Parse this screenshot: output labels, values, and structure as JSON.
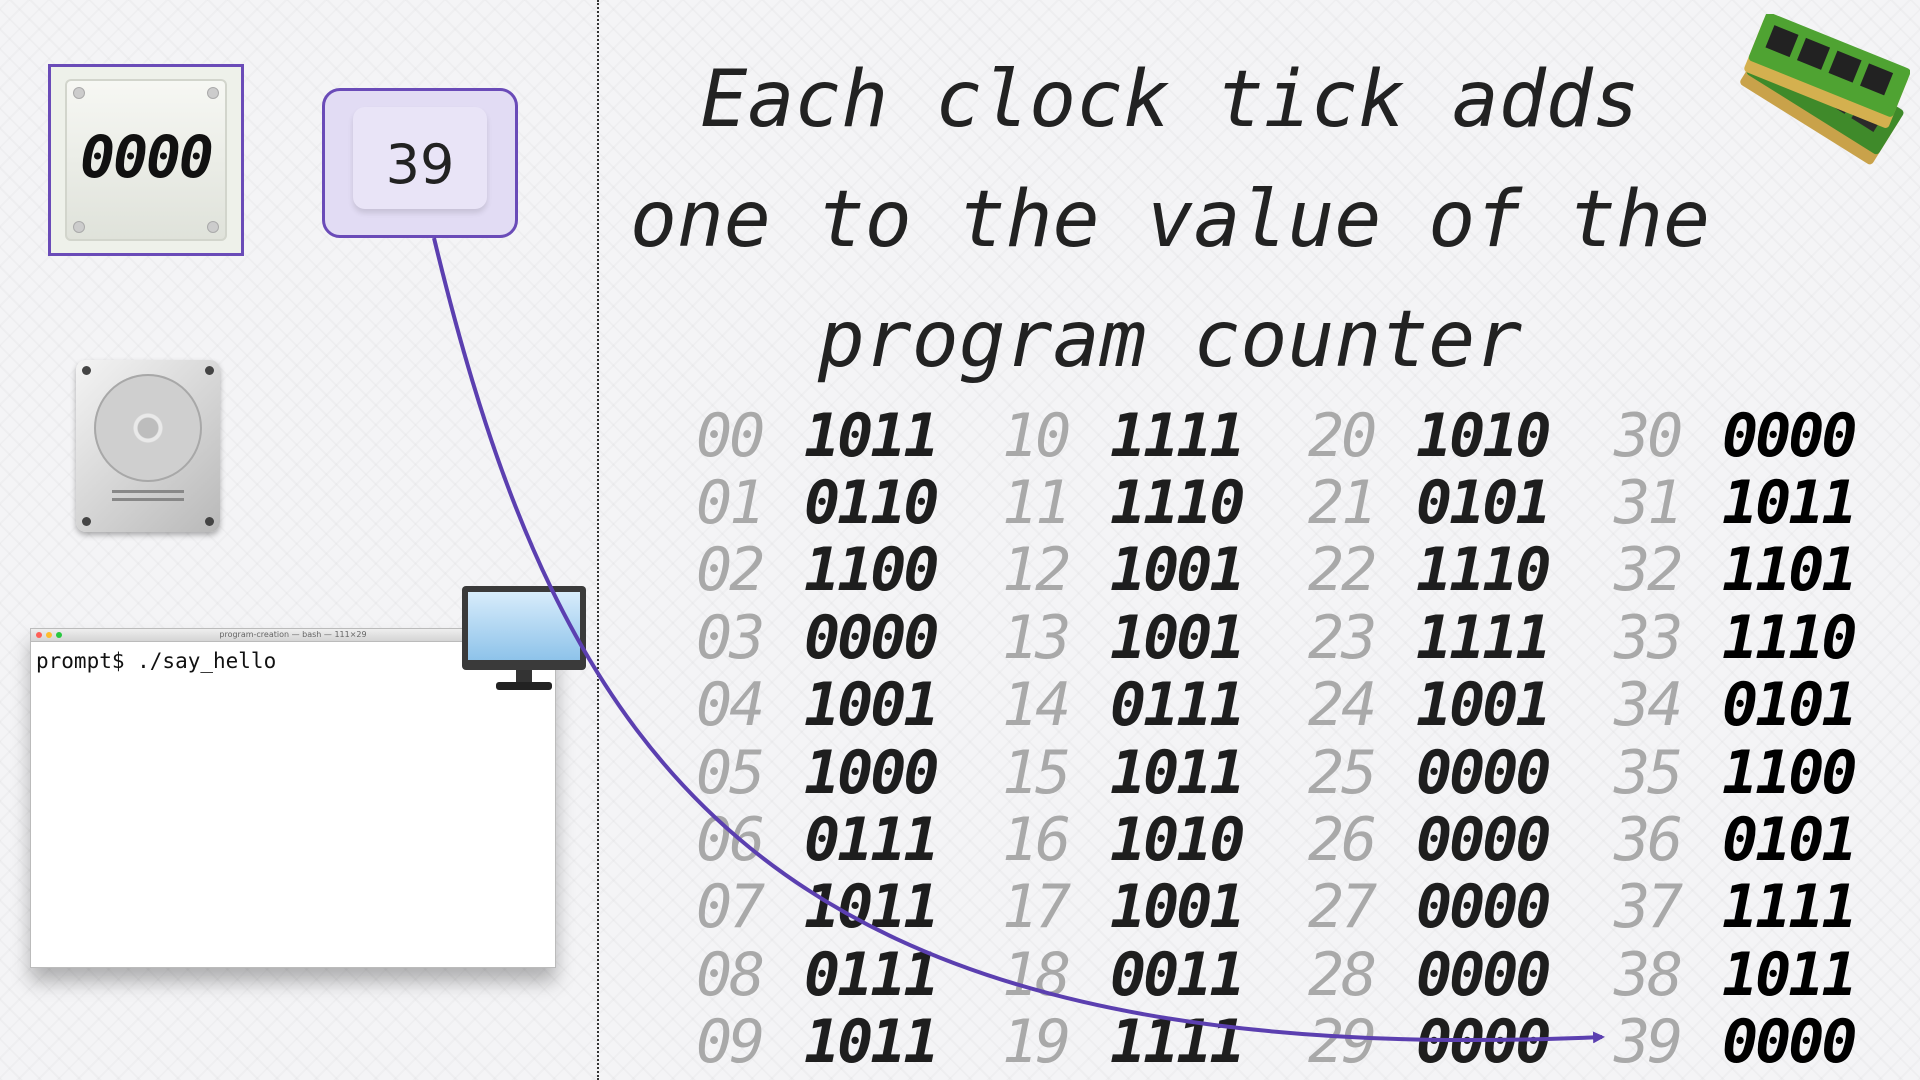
{
  "title_lines": [
    "Each clock tick adds",
    "one to the value of the",
    "program counter"
  ],
  "register_value": "0000",
  "program_counter_value": "39",
  "terminal": {
    "window_title": "program-creation — bash — 111×29",
    "prompt_line": "prompt$ ./say_hello"
  },
  "memory": [
    {
      "address": "00",
      "value": "1011"
    },
    {
      "address": "01",
      "value": "0110"
    },
    {
      "address": "02",
      "value": "1100"
    },
    {
      "address": "03",
      "value": "0000"
    },
    {
      "address": "04",
      "value": "1001"
    },
    {
      "address": "05",
      "value": "1000"
    },
    {
      "address": "06",
      "value": "0111"
    },
    {
      "address": "07",
      "value": "1011"
    },
    {
      "address": "08",
      "value": "0111"
    },
    {
      "address": "09",
      "value": "1011"
    },
    {
      "address": "10",
      "value": "1111"
    },
    {
      "address": "11",
      "value": "1110"
    },
    {
      "address": "12",
      "value": "1001"
    },
    {
      "address": "13",
      "value": "1001"
    },
    {
      "address": "14",
      "value": "0111"
    },
    {
      "address": "15",
      "value": "1011"
    },
    {
      "address": "16",
      "value": "1010"
    },
    {
      "address": "17",
      "value": "1001"
    },
    {
      "address": "18",
      "value": "0011"
    },
    {
      "address": "19",
      "value": "1111"
    },
    {
      "address": "20",
      "value": "1010"
    },
    {
      "address": "21",
      "value": "0101"
    },
    {
      "address": "22",
      "value": "1110"
    },
    {
      "address": "23",
      "value": "1111"
    },
    {
      "address": "24",
      "value": "1001"
    },
    {
      "address": "25",
      "value": "0000"
    },
    {
      "address": "26",
      "value": "0000"
    },
    {
      "address": "27",
      "value": "0000"
    },
    {
      "address": "28",
      "value": "0000"
    },
    {
      "address": "29",
      "value": "0000"
    },
    {
      "address": "30",
      "value": "0000"
    },
    {
      "address": "31",
      "value": "1011"
    },
    {
      "address": "32",
      "value": "1101"
    },
    {
      "address": "33",
      "value": "1110"
    },
    {
      "address": "34",
      "value": "0101"
    },
    {
      "address": "35",
      "value": "1100"
    },
    {
      "address": "36",
      "value": "0101"
    },
    {
      "address": "37",
      "value": "1111"
    },
    {
      "address": "38",
      "value": "1011"
    },
    {
      "address": "39",
      "value": "0000"
    }
  ],
  "pointer_target_address": "39",
  "colors": {
    "accent": "#5b3fb0",
    "address": "#a9a9a9",
    "bits": "#1e1e1e"
  },
  "icons": [
    "ram-module-icon",
    "hard-disk-icon",
    "monitor-icon",
    "register-chip-icon"
  ]
}
